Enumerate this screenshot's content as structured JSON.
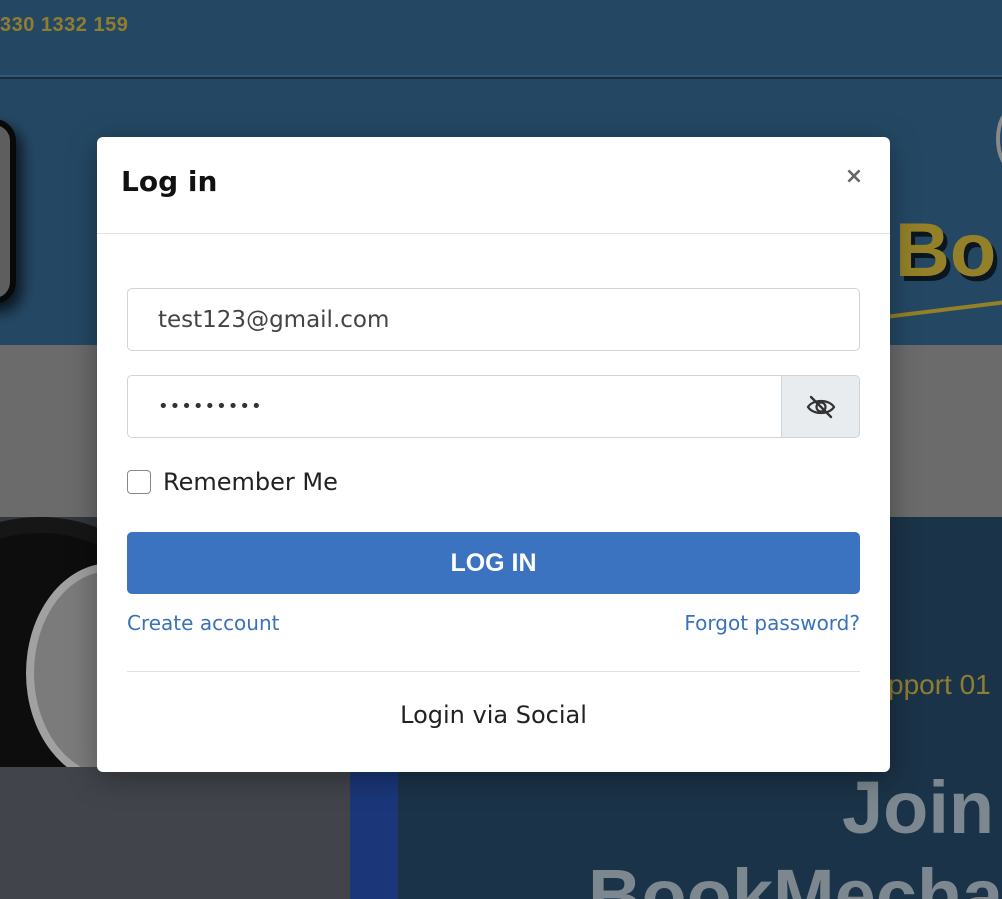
{
  "background": {
    "topbar": {
      "phone": "330 1332 159"
    },
    "hero": {
      "logo_text": "Bo"
    },
    "lower_right": {
      "support_text": "pport 01",
      "join_text": "Join",
      "brand_text": "BookMecha"
    }
  },
  "modal": {
    "title": "Log in",
    "close_symbol": "×",
    "email": {
      "value": "test123@gmail.com",
      "placeholder": ""
    },
    "password": {
      "value": "123456789",
      "toggle_icon": "eye-slash-icon"
    },
    "remember_label": "Remember Me",
    "remember_checked": false,
    "login_button": "LOG IN",
    "create_account_link": "Create account",
    "forgot_password_link": "Forgot password?",
    "social_text": "Login via Social"
  },
  "colors": {
    "primary_button": "#3b73c0",
    "link": "#3a72b8",
    "brand_gold": "#a58f38",
    "header_blue": "#2a5272"
  }
}
